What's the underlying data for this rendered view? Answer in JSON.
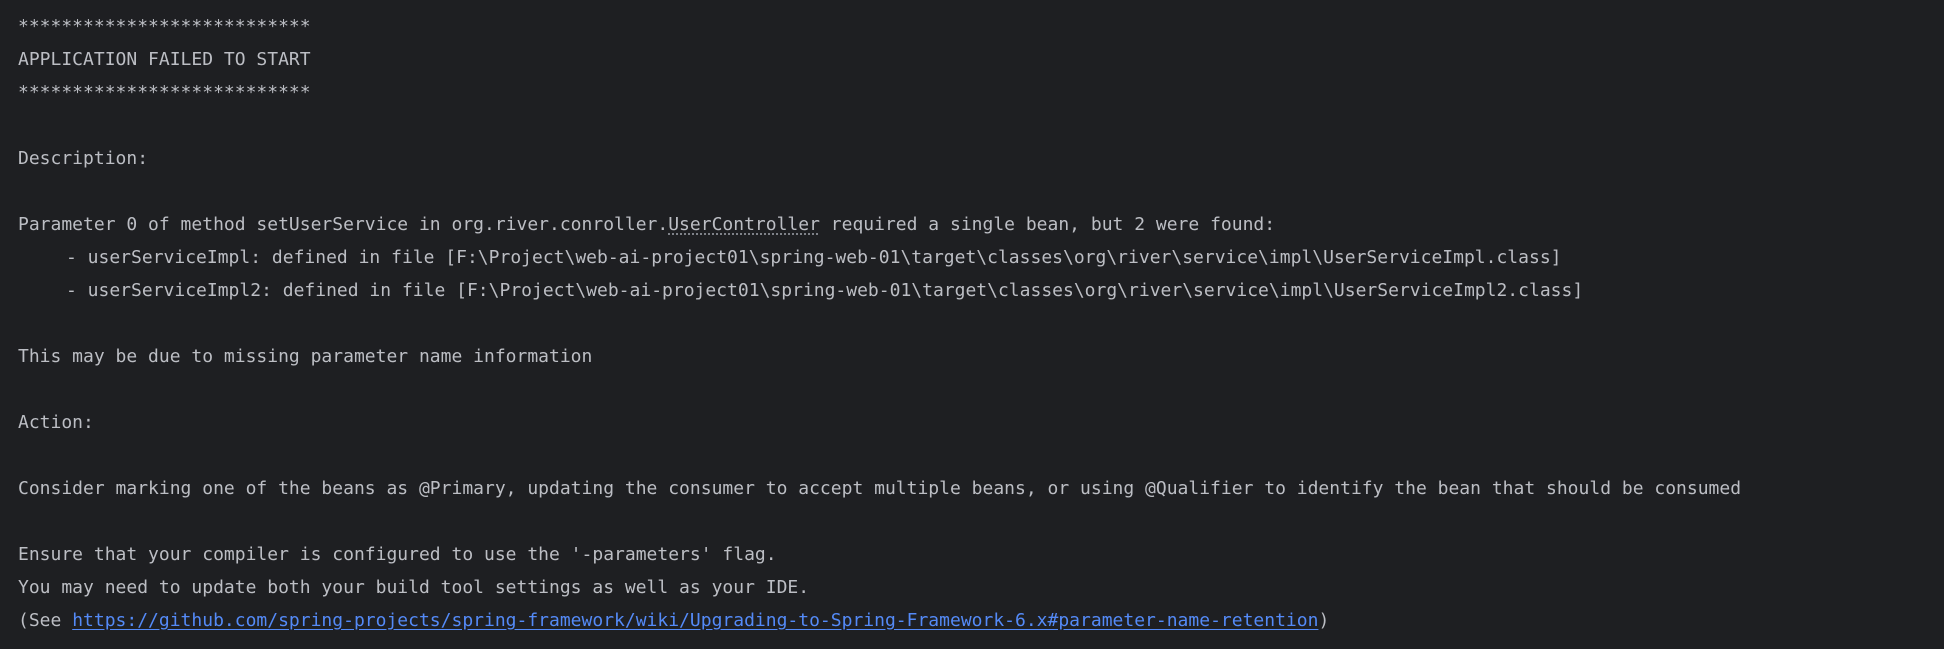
{
  "console": {
    "stars_top": "***************************",
    "title": "APPLICATION FAILED TO START",
    "stars_bottom": "***************************",
    "description_label": "Description:",
    "param_prefix": "Parameter 0 of method setUserService in org.river.conroller.",
    "param_class": "UserController",
    "param_suffix": " required a single bean, but 2 were found:",
    "bean1": "- userServiceImpl: defined in file [F:\\Project\\web-ai-project01\\spring-web-01\\target\\classes\\org\\river\\service\\impl\\UserServiceImpl.class]",
    "bean2": "- userServiceImpl2: defined in file [F:\\Project\\web-ai-project01\\spring-web-01\\target\\classes\\org\\river\\service\\impl\\UserServiceImpl2.class]",
    "missing_info": "This may be due to missing parameter name information",
    "action_label": "Action:",
    "consider": "Consider marking one of the beans as @Primary, updating the consumer to accept multiple beans, or using @Qualifier to identify the bean that should be consumed",
    "ensure": "Ensure that your compiler is configured to use the '-parameters' flag.",
    "update": "You may need to update both your build tool settings as well as your IDE.",
    "see_prefix": "(See ",
    "see_url": "https://github.com/spring-projects/spring-framework/wiki/Upgrading-to-Spring-Framework-6.x#parameter-name-retention",
    "see_suffix": ")"
  },
  "colors": {
    "background": "#1e1f22",
    "text": "#bcbec4",
    "link": "#548af7"
  }
}
